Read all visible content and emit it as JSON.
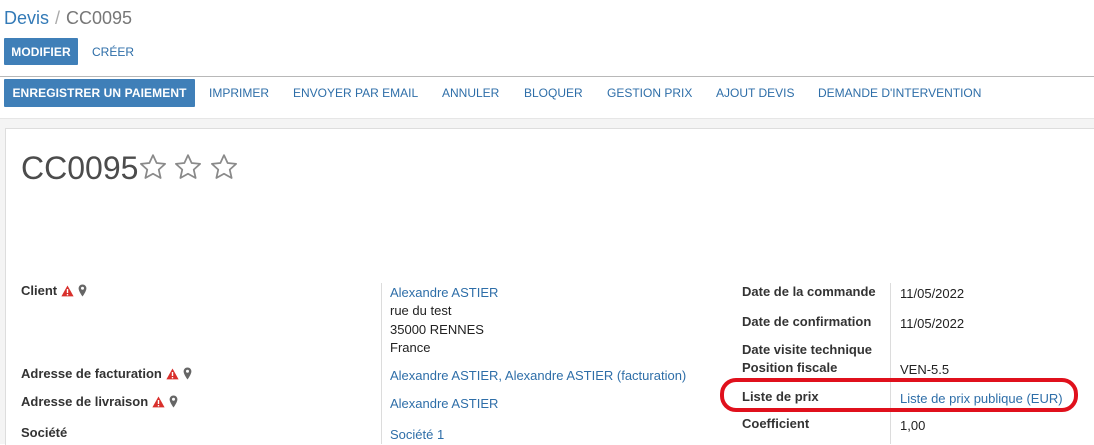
{
  "breadcrumb": {
    "parent": "Devis",
    "separator": "/",
    "current": "CC0095"
  },
  "actions": {
    "edit": "MODIFIER",
    "create": "CRÉER"
  },
  "toolbar": {
    "primary": "ENREGISTRER UN PAIEMENT",
    "buttons": [
      "IMPRIMER",
      "ENVOYER PAR EMAIL",
      "ANNULER",
      "BLOQUER",
      "GESTION PRIX",
      "AJOUT DEVIS",
      "DEMANDE D'INTERVENTION"
    ]
  },
  "record": {
    "name": "CC0095",
    "stars": 3,
    "stars_filled": 0
  },
  "left_fields": {
    "client": {
      "label": "Client",
      "name": "Alexandre ASTIER",
      "address_lines": [
        "rue du test",
        "35000 RENNES",
        "France"
      ]
    },
    "invoice_address": {
      "label": "Adresse de facturation",
      "value": "Alexandre ASTIER, Alexandre ASTIER (facturation)"
    },
    "delivery_address": {
      "label": "Adresse de livraison",
      "value": "Alexandre ASTIER"
    },
    "company": {
      "label": "Société",
      "value": "Société 1"
    }
  },
  "right_fields": {
    "order_date": {
      "label": "Date de la commande",
      "value": "11/05/2022"
    },
    "confirmation_date": {
      "label": "Date de confirmation",
      "value": "11/05/2022"
    },
    "visit_date": {
      "label": "Date visite technique",
      "value": ""
    },
    "fiscal_position": {
      "label": "Position fiscale",
      "value": "VEN-5.5"
    },
    "pricelist": {
      "label": "Liste de prix",
      "value": "Liste de prix publique (EUR)"
    },
    "coefficient": {
      "label": "Coefficient",
      "value": "1,00"
    }
  },
  "colors": {
    "primary": "#3f7fb8",
    "link": "#2e6ea8",
    "warning": "#d9302c",
    "highlight": "#e0101c"
  },
  "icons": {
    "warning": "warning-triangle-icon",
    "location": "map-marker-icon",
    "star": "star-outline-icon"
  }
}
